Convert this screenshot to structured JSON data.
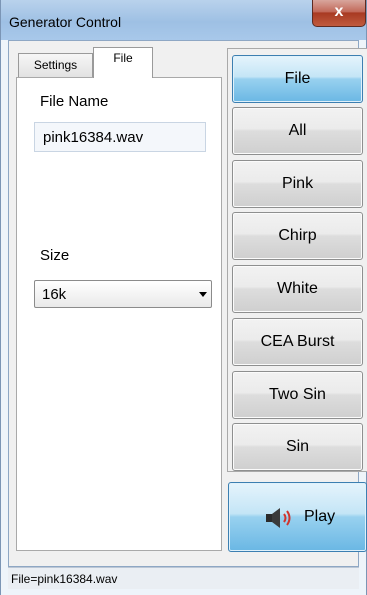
{
  "window": {
    "title": "Generator Control",
    "close_label": "x"
  },
  "tabs": [
    {
      "label": "Settings",
      "selected": false
    },
    {
      "label": "File",
      "selected": true
    }
  ],
  "file_tab": {
    "file_name_label": "File Name",
    "file_name_value": "pink16384.wav",
    "size_label": "Size",
    "size_value": "16k"
  },
  "generator_buttons": [
    {
      "label": "File",
      "active": true
    },
    {
      "label": "All",
      "active": false
    },
    {
      "label": "Pink",
      "active": false
    },
    {
      "label": "Chirp",
      "active": false
    },
    {
      "label": "White",
      "active": false
    },
    {
      "label": "CEA Burst",
      "active": false
    },
    {
      "label": "Two Sin",
      "active": false
    },
    {
      "label": "Sin",
      "active": false
    }
  ],
  "play_button": {
    "label": "Play",
    "icon": "speaker-icon"
  },
  "status_bar": {
    "text": "File=pink16384.wav"
  },
  "colors": {
    "active_button": "#98d1ef",
    "titlebar": "#b9d2ec",
    "close_button": "#c26a5a"
  }
}
